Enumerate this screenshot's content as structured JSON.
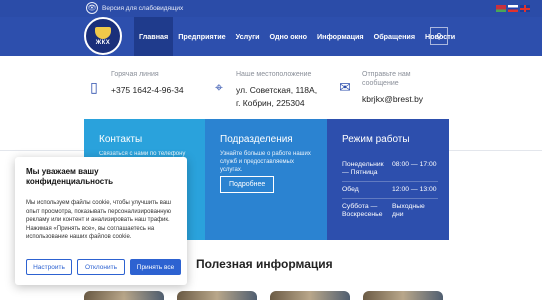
{
  "header": {
    "accessibility_label": "Версия для слабовидящих",
    "logo_text": "ЖКХ",
    "languages": [
      "by",
      "ru",
      "en"
    ]
  },
  "nav": {
    "items": [
      {
        "label": "Главная",
        "active": true
      },
      {
        "label": "Предприятие",
        "active": false
      },
      {
        "label": "Услуги",
        "active": false
      },
      {
        "label": "Одно окно",
        "active": false
      },
      {
        "label": "Информация",
        "active": false
      },
      {
        "label": "Обращения",
        "active": false
      },
      {
        "label": "Новости",
        "active": false
      }
    ]
  },
  "contacts": {
    "phone": {
      "label": "Горячая линия",
      "value": "+375 1642-4-96-34",
      "icon": "phone-icon"
    },
    "address": {
      "label": "Наше местоположение",
      "line1": "ул. Советская, 118А,",
      "line2": "г. Кобрин, 225304",
      "icon": "map-pin-icon"
    },
    "email": {
      "label_line1": "Отправьте нам",
      "label_line2": "сообщение",
      "value": "kbrjkx@brest.by",
      "icon": "mail-icon"
    }
  },
  "blocks": {
    "contacts": {
      "title": "Контакты",
      "text": "Связаться с нами по телефону или"
    },
    "departments": {
      "title": "Подразделения",
      "text": "Узнайте больше о работе наших служб и предоставляемых услугах.",
      "button": "Подробнее"
    },
    "schedule": {
      "title": "Режим работы",
      "rows": [
        {
          "days": "Понедельник — Пятница",
          "time": "08:00 — 17:00"
        },
        {
          "days": "Обед",
          "time": "12:00 — 13:00"
        },
        {
          "days": "Суббота — Воскресенье",
          "time": "Выходные дни"
        }
      ]
    }
  },
  "cookie": {
    "title": "Мы уважаем вашу конфиденциальность",
    "text": "Мы используем файлы cookie, чтобы улучшить ваш опыт просмотра, показывать персонализированную рекламу или контент и анализировать наш трафик. Нажимая «Принять все», вы соглашаетесь на использование наших файлов cookie.",
    "customize": "Настроить",
    "reject": "Отклонить",
    "accept": "Принять все"
  },
  "useful": {
    "title": "Полезная информация"
  },
  "colors": {
    "primary": "#2d4fad",
    "light_blue": "#2aa2dc",
    "mid_blue": "#2b83d1",
    "button_blue": "#2d62d1"
  }
}
